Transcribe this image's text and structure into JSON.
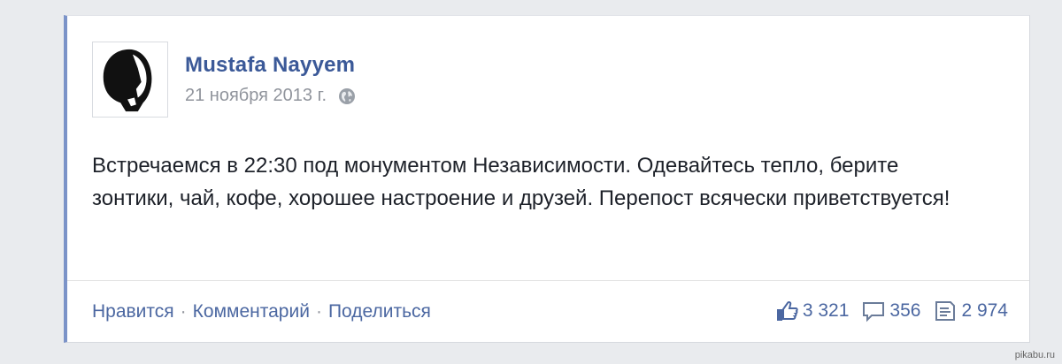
{
  "post": {
    "author": "Mustafa Nayyem",
    "date": "21 ноября 2013 г.",
    "privacy_icon": "globe-icon",
    "avatar_icon": "portrait-avatar",
    "text": "Встречаемся в 22:30 под монументом Независимости. Одевайтесь тепло, берите зонтики, чай, кофе, хорошее настроение и друзей. Перепост всячески приветствуется!",
    "accent_color": "#3b5998"
  },
  "actions": {
    "like": "Нравится",
    "comment": "Комментарий",
    "share": "Поделиться",
    "separator": "·"
  },
  "stats": {
    "likes": "3 321",
    "comments": "356",
    "shares": "2 974",
    "like_icon": "thumbs-up-icon",
    "comment_icon": "comment-icon",
    "share_icon": "share-icon"
  },
  "watermark": "pikabu.ru"
}
